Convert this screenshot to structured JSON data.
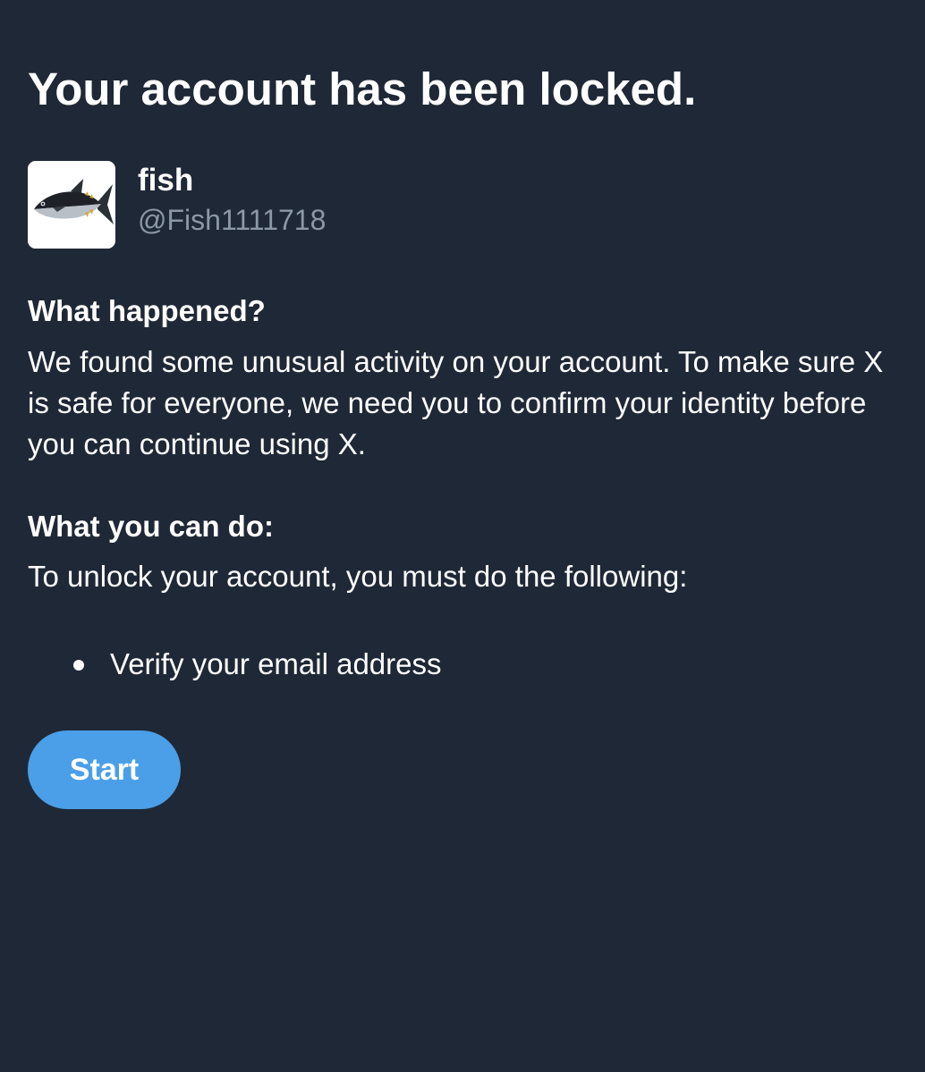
{
  "page": {
    "title": "Your account has been locked."
  },
  "profile": {
    "display_name": "fish",
    "handle": "@Fish1111718",
    "avatar_icon": "tuna-fish-avatar"
  },
  "what_happened": {
    "heading": "What happened?",
    "body": "We found some unusual activity on your account. To make sure X is safe for everyone, we need you to confirm your identity before you can continue using X."
  },
  "what_you_can_do": {
    "heading": "What you can do:",
    "body": "To unlock your account, you must do the following:",
    "steps": [
      {
        "label": "Verify your email address"
      }
    ]
  },
  "actions": {
    "start_label": "Start"
  },
  "colors": {
    "background": "#1f2836",
    "text": "#ffffff",
    "secondary_text": "#8b98a5",
    "accent": "#4a9fe8"
  }
}
